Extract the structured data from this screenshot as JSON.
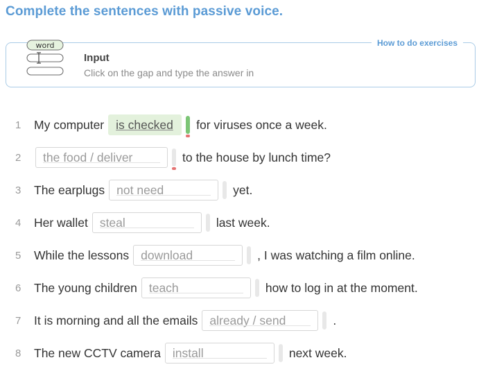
{
  "page": {
    "title": "Complete the sentences with passive voice."
  },
  "instructions": {
    "howto_label": "How to do exercises",
    "icon_word_label": "word",
    "title": "Input",
    "text": "Click on the gap and type the answer in"
  },
  "items": [
    {
      "num": "1",
      "pre": "My computer",
      "gap": "is checked",
      "post": "for viruses once a week.",
      "filled": true
    },
    {
      "num": "2",
      "pre": "",
      "gap": "the food / deliver",
      "post": "to the house by lunch time?",
      "filled": false
    },
    {
      "num": "3",
      "pre": "The earplugs",
      "gap": "not need",
      "post": "yet.",
      "filled": false
    },
    {
      "num": "4",
      "pre": "Her wallet",
      "gap": "steal",
      "post": "last week.",
      "filled": false
    },
    {
      "num": "5",
      "pre": "While the lessons",
      "gap": "download",
      "post": ", I was watching a film online.",
      "filled": false
    },
    {
      "num": "6",
      "pre": "The young children",
      "gap": "teach",
      "post": "how to log in at the moment.",
      "filled": false
    },
    {
      "num": "7",
      "pre": "It is morning and all the emails",
      "gap": "already / send",
      "post": ".",
      "filled": false
    },
    {
      "num": "8",
      "pre": "The new CCTV camera",
      "gap": "install",
      "post": "next week.",
      "filled": false
    }
  ],
  "colors": {
    "accent": "#5b9bd5",
    "filled_gap": "#e3f1dc",
    "correct_bar": "#7cc576",
    "error_mark": "#e57373"
  }
}
